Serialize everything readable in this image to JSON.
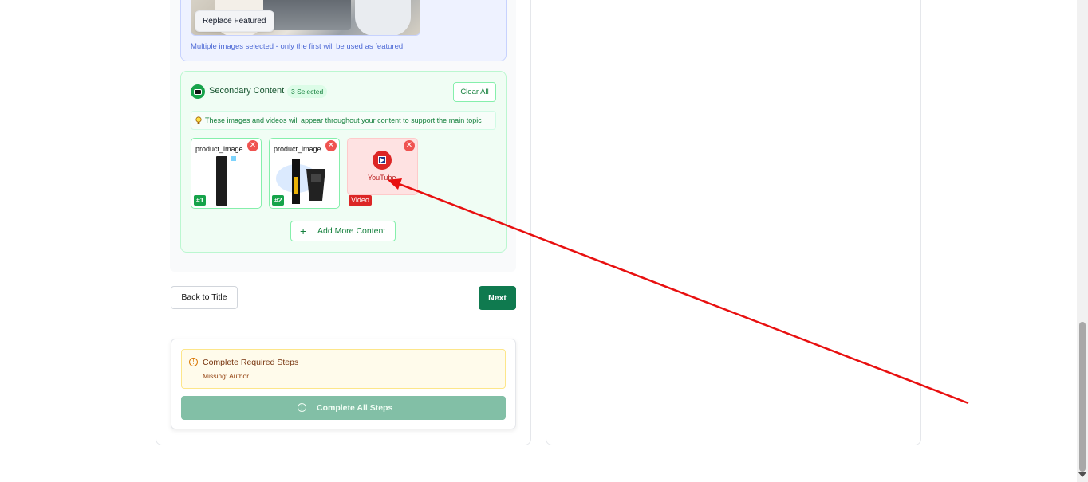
{
  "featured": {
    "replace_label": "Replace Featured",
    "note": "Multiple images selected - only the first will be used as featured"
  },
  "secondary": {
    "title": "Secondary Content",
    "badge": "3 Selected",
    "clear_label": "Clear All",
    "tip": "These images and videos will appear throughout your content to support the main topic",
    "items": [
      {
        "label": "product_image",
        "number": "#1",
        "remove": "✕"
      },
      {
        "label": "product_image",
        "number": "#2",
        "remove": "✕"
      },
      {
        "label": "YouTube",
        "badge": "Video",
        "remove": "✕"
      }
    ],
    "add_label": "Add More Content",
    "add_icon": "+"
  },
  "nav": {
    "back_label": "Back to Title",
    "next_label": "Next"
  },
  "status": {
    "warning_title": "Complete Required Steps",
    "warning_missing": "Missing: Author",
    "complete_label": "Complete All Steps",
    "icon_glyph": "!"
  },
  "colors": {
    "accent_green": "#0f7a4f",
    "video_red": "#dc2626",
    "annotation_arrow": "#e81010"
  }
}
